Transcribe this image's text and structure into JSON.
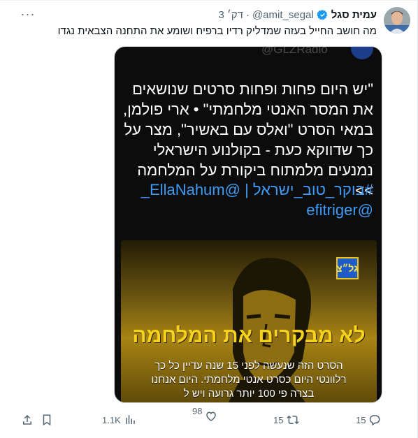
{
  "tweet": {
    "author_name": "עמית סגל",
    "handle": "@amit_segal",
    "dot": "·",
    "time": "3 דק׳",
    "more": "···",
    "text": "מה חושב החייל בעזה שמדליק רדיו ברפיח ושומע את התחנה הצבאית נגדו"
  },
  "media": {
    "watermark": "@GLZRadio",
    "quote": "\"יש היום פחות ופחות סרטים שנושאים את המסר האנטי מלחמתי\" • ארי פולמן, במאי הסרט \"ואלס עם באשיר\", מצר על כך שדווקא כעת - בקולנוע הישראלי נמנעים מלמתוח ביקורת על המלחמה >>",
    "hashtags": "#בוקר_טוב_ישראל | @EllaNahum_\n@efitriger",
    "poster_badge": "גל״צ",
    "poster_title": "לא מבקרים את המלחמה",
    "poster_body": "הסרט הזה שנעשה לפני 15 שנה עדיין כל כך\nרלוונטי היום כסרט אנטי מלחמתי. היום אנחנו\nבצרה פי 100 יותר גרועה ויש ל"
  },
  "actions": {
    "replies": "15",
    "retweets": "15",
    "likes": "98",
    "views": "1.1K"
  },
  "colors": {
    "accent": "#1d9bf0",
    "secondary_text": "#536471",
    "hashtag": "#3e9bf5",
    "poster_title": "#f6d21c"
  },
  "icons": [
    "more-icon",
    "verified-icon",
    "reply-icon",
    "retweet-icon",
    "like-icon",
    "views-icon",
    "bookmark-icon",
    "share-icon"
  ]
}
